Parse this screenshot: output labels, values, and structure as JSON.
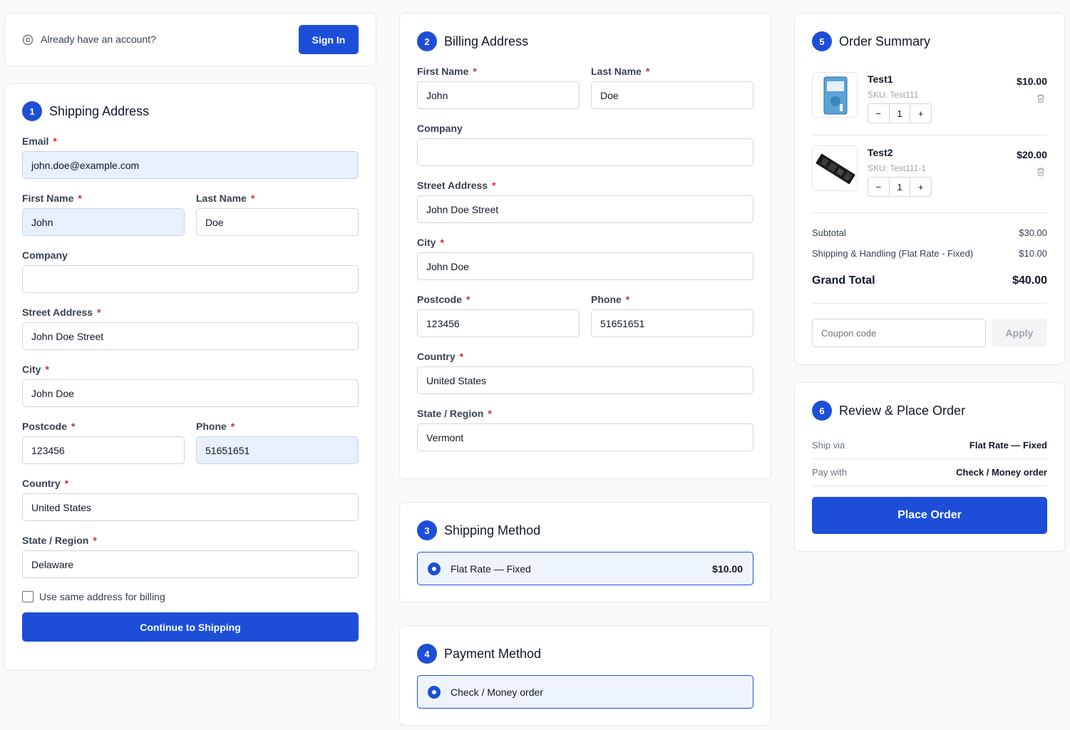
{
  "signin": {
    "prompt": "Already have an account?",
    "button": "Sign In"
  },
  "shipping": {
    "step": "1",
    "title": "Shipping Address",
    "email_label": "Email",
    "email": "john.doe@example.com",
    "first_name_label": "First Name",
    "first_name": "John",
    "last_name_label": "Last Name",
    "last_name": "Doe",
    "company_label": "Company",
    "company": "",
    "street_label": "Street Address",
    "street": "John Doe Street",
    "city_label": "City",
    "city": "John Doe",
    "postcode_label": "Postcode",
    "postcode": "123456",
    "phone_label": "Phone",
    "phone": "51651651",
    "country_label": "Country",
    "country": "United States",
    "state_label": "State / Region",
    "state": "Delaware",
    "same_billing_label": "Use same address for billing",
    "continue_button": "Continue to Shipping"
  },
  "billing": {
    "step": "2",
    "title": "Billing Address",
    "first_name_label": "First Name",
    "first_name": "John",
    "last_name_label": "Last Name",
    "last_name": "Doe",
    "company_label": "Company",
    "company": "",
    "street_label": "Street Address",
    "street": "John Doe Street",
    "city_label": "City",
    "city": "John Doe",
    "postcode_label": "Postcode",
    "postcode": "123456",
    "phone_label": "Phone",
    "phone": "51651651",
    "country_label": "Country",
    "country": "United States",
    "state_label": "State / Region",
    "state": "Vermont"
  },
  "shipping_method": {
    "step": "3",
    "title": "Shipping Method",
    "option": "Flat Rate — Fixed",
    "price": "$10.00"
  },
  "payment_method": {
    "step": "4",
    "title": "Payment Method",
    "option": "Check / Money order"
  },
  "summary": {
    "step": "5",
    "title": "Order Summary",
    "items": [
      {
        "name": "Test1",
        "sku": "SKU: Test111",
        "qty": "1",
        "price": "$10.00",
        "minus": "−",
        "plus": "+"
      },
      {
        "name": "Test2",
        "sku": "SKU: Test111-1",
        "qty": "1",
        "price": "$20.00",
        "minus": "−",
        "plus": "+"
      }
    ],
    "subtotal_label": "Subtotal",
    "subtotal": "$30.00",
    "shipping_label": "Shipping & Handling (Flat Rate - Fixed)",
    "shipping": "$10.00",
    "grand_total_label": "Grand Total",
    "grand_total": "$40.00",
    "coupon_placeholder": "Coupon code",
    "apply_button": "Apply"
  },
  "review": {
    "step": "6",
    "title": "Review & Place Order",
    "ship_via_label": "Ship via",
    "ship_via": "Flat Rate — Fixed",
    "pay_with_label": "Pay with",
    "pay_with": "Check / Money order",
    "place_order_button": "Place Order"
  },
  "colors": {
    "primary": "#1d4ed8",
    "autofill": "#e8effd",
    "required": "#dc2626"
  }
}
